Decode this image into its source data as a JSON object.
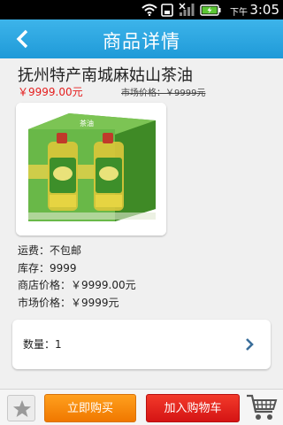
{
  "status_bar": {
    "ampm": "下午",
    "time": "3:05",
    "icons": [
      "wifi-icon",
      "sim-icon",
      "signal-icon",
      "battery-charging-icon"
    ]
  },
  "header": {
    "title": "商品详情",
    "back_icon": "chevron-left-icon"
  },
  "product": {
    "title": "抚州特产南城麻姑山茶油",
    "price": "￥9999.00元",
    "market_price_strike": "市场价格：￥9999元",
    "image_alt": "product-image-camellia-oil"
  },
  "info": {
    "shipping": "运费：不包邮",
    "stock": "库存：9999",
    "store_price": "商店价格：￥9999.00元",
    "market_price": "市场价格：￥9999元"
  },
  "quantity": {
    "label": "数量：1",
    "chevron_icon": "chevron-right-icon"
  },
  "bottom_bar": {
    "favorite_icon": "star-icon",
    "buy_now_label": "立即购买",
    "add_to_cart_label": "加入购物车",
    "cart_icon": "shopping-cart-icon"
  },
  "colors": {
    "header_blue": "#2aa6e0",
    "price_red": "#e41e1e",
    "buy_orange": "#f58a0a",
    "cart_red": "#e02020"
  }
}
